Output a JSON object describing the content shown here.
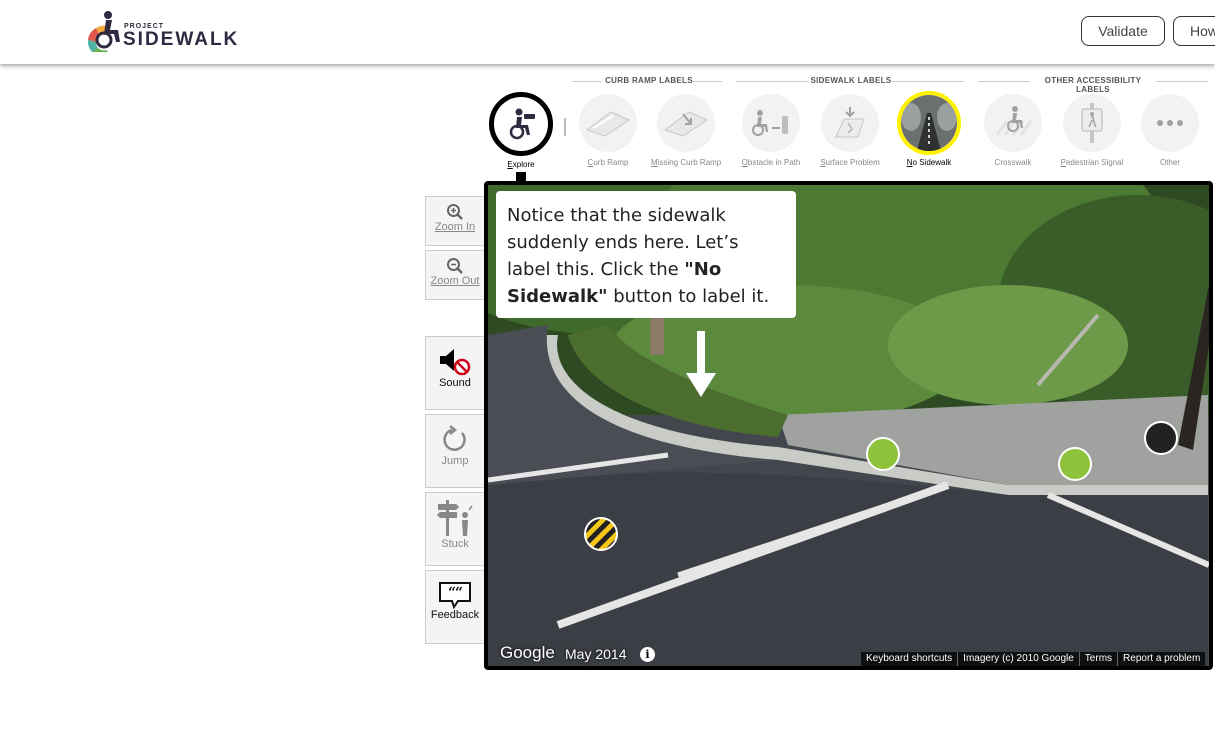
{
  "header": {
    "logo_project": "PROJECT",
    "logo_sidewalk": "SIDEWALK",
    "validate_label": "Validate",
    "how_label": "How"
  },
  "toolbar": {
    "groups": [
      {
        "title": "CURB RAMP LABELS"
      },
      {
        "title": "SIDEWALK LABELS"
      },
      {
        "title": "OTHER ACCESSIBILITY LABELS"
      }
    ],
    "tools": [
      {
        "key": "E",
        "rest": "xplore",
        "icon": "explore-icon"
      },
      {
        "key": "C",
        "rest": "urb Ramp",
        "icon": "curb-ramp-icon"
      },
      {
        "key": "M",
        "rest": "issing Curb Ramp",
        "icon": "missing-curb-ramp-icon"
      },
      {
        "key": "O",
        "rest": "bstacle in Path",
        "icon": "obstacle-icon"
      },
      {
        "key": "S",
        "rest": "urface Problem",
        "icon": "surface-problem-icon"
      },
      {
        "key": "N",
        "rest": "o Sidewalk",
        "icon": "no-sidewalk-icon"
      },
      {
        "key": "",
        "rest": "Crosswalk",
        "icon": "crosswalk-icon"
      },
      {
        "key": "P",
        "rest": "edestrian Signal",
        "icon": "pedestrian-signal-icon"
      },
      {
        "key": "",
        "rest": "Other",
        "icon": "other-icon"
      }
    ]
  },
  "controls": {
    "zoom_in": "Zoom In",
    "zoom_out": "Zoom Out",
    "sound": "Sound",
    "jump": "Jump",
    "stuck": "Stuck",
    "feedback": "Feedback"
  },
  "pano": {
    "callout_1": "Notice that the sidewalk suddenly ends here. Let’s label this. Click the ",
    "callout_em": "\"No Sidewalk\"",
    "callout_2": " button to label it.",
    "google": "Google",
    "date": "May 2014",
    "info": "i",
    "attr": [
      "Keyboard shortcuts",
      "Imagery (c) 2010 Google",
      "Terms",
      "Report a problem"
    ]
  },
  "colors": {
    "highlight": "#fff200",
    "brand_dark": "#2f2a41",
    "curb_marker": "#8fc23b",
    "surface_marker": "#f5c518"
  }
}
